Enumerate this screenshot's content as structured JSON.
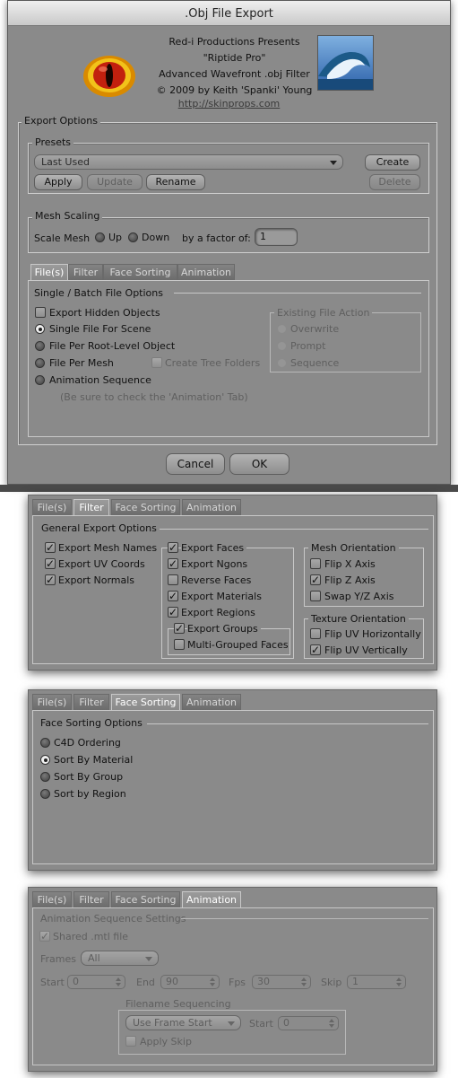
{
  "window": {
    "title": ".Obj File Export"
  },
  "header": {
    "credits": [
      "Red-i Productions Presents",
      "\"Riptide Pro\"",
      "Advanced Wavefront .obj Filter",
      "© 2009 by Keith 'Spanki' Young"
    ],
    "link": "http://skinprops.com",
    "logo_icon": "red-eye-logo-icon",
    "wave_icon": "wave-image-icon"
  },
  "export_options": {
    "title": "Export Options",
    "presets": {
      "title": "Presets",
      "selected": "Last Used",
      "buttons": {
        "apply": "Apply",
        "update": "Update",
        "rename": "Rename",
        "create": "Create",
        "delete": "Delete"
      }
    },
    "mesh_scaling": {
      "title": "Mesh Scaling",
      "label": "Scale Mesh",
      "up": "Up",
      "down": "Down",
      "factor_label": "by a factor of:",
      "factor_value": "1"
    }
  },
  "tabs": [
    "File(s)",
    "Filter",
    "Face Sorting",
    "Animation"
  ],
  "files_tab": {
    "group_title": "Single / Batch  File Options",
    "export_hidden": "Export Hidden Objects",
    "options": [
      "Single File For Scene",
      "File Per Root-Level Object",
      "File Per Mesh",
      "Animation Sequence"
    ],
    "create_tree": "Create Tree Folders",
    "note": "(Be sure to check the 'Animation' Tab)",
    "existing": {
      "title": "Existing File Action",
      "options": [
        "Overwrite",
        "Prompt",
        "Sequence"
      ]
    }
  },
  "footer": {
    "cancel": "Cancel",
    "ok": "OK"
  },
  "filter_tab": {
    "group_title": "General Export Options",
    "col1": [
      "Export Mesh Names",
      "Export UV Coords",
      "Export Normals"
    ],
    "export_faces": "Export Faces",
    "faces_items": [
      "Export Ngons",
      "Reverse Faces",
      "Export Materials",
      "Export Regions"
    ],
    "export_groups": "Export Groups",
    "multi_grouped": "Multi-Grouped Faces",
    "mesh_orientation": {
      "title": "Mesh Orientation",
      "items": [
        "Flip X Axis",
        "Flip Z Axis",
        "Swap Y/Z Axis"
      ]
    },
    "texture_orientation": {
      "title": "Texture Orientation",
      "items": [
        "Flip UV Horizontally",
        "Flip UV Vertically"
      ]
    }
  },
  "face_sorting_tab": {
    "group_title": "Face Sorting Options",
    "options": [
      "C4D Ordering",
      "Sort By Material",
      "Sort By Group",
      "Sort by Region"
    ]
  },
  "animation_tab": {
    "group_title": "Animation Sequence Settings",
    "shared_mtl": "Shared .mtl file",
    "frames_label": "Frames",
    "frames_value": "All",
    "start_label": "Start",
    "start_value": "0",
    "end_label": "End",
    "end_value": "90",
    "fps_label": "Fps",
    "fps_value": "30",
    "skip_label": "Skip",
    "skip_value": "1",
    "filename_seq": {
      "title": "Filename Sequencing",
      "mode": "Use Frame Start",
      "start_label": "Start",
      "start_value": "0",
      "apply_skip": "Apply Skip"
    }
  }
}
